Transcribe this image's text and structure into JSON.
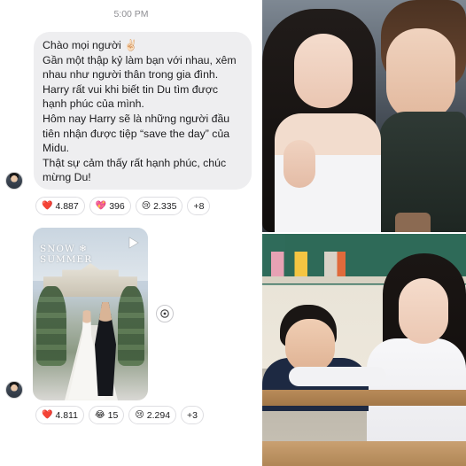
{
  "chat": {
    "timestamp": "5:00 PM",
    "message": {
      "lines": [
        "Chào mọi người ✌🏻",
        "Gần một thập kỷ làm bạn với nhau, xêm nhau như người thân trong gia đình.",
        "Harry rất vui khi biết tin Du tìm được hạnh phúc của mình.",
        "Hôm nay Harry sẽ là những người đầu tiên nhận được tiệp “save the day” của Midu.",
        "Thật sự cảm thấy rất hạnh phúc, chúc mừng Du!"
      ]
    },
    "reactions_1": [
      {
        "emoji": "❤️",
        "icon": "heart-icon",
        "count": "4.887"
      },
      {
        "emoji": "💖",
        "icon": "sparkling-heart-icon",
        "count": "396"
      },
      {
        "emoji": "😢",
        "icon": "crying-face-icon",
        "count": "2.335"
      }
    ],
    "reactions_1_more": "+8",
    "media": {
      "overlay_title": "SNOW ❄ SUMMER",
      "play_icon": "play-icon"
    },
    "share_icon": "share-icon",
    "reactions_2": [
      {
        "emoji": "❤️",
        "icon": "heart-icon",
        "count": "4.811"
      },
      {
        "emoji": "😂",
        "icon": "laughing-face-icon",
        "count": "15"
      },
      {
        "emoji": "😢",
        "icon": "crying-face-icon",
        "count": "2.294"
      }
    ],
    "reactions_2_more": "+3"
  },
  "colors": {
    "bubble": "#eeeef0",
    "timestamp": "#8e8e93",
    "text": "#1c1c1e"
  }
}
